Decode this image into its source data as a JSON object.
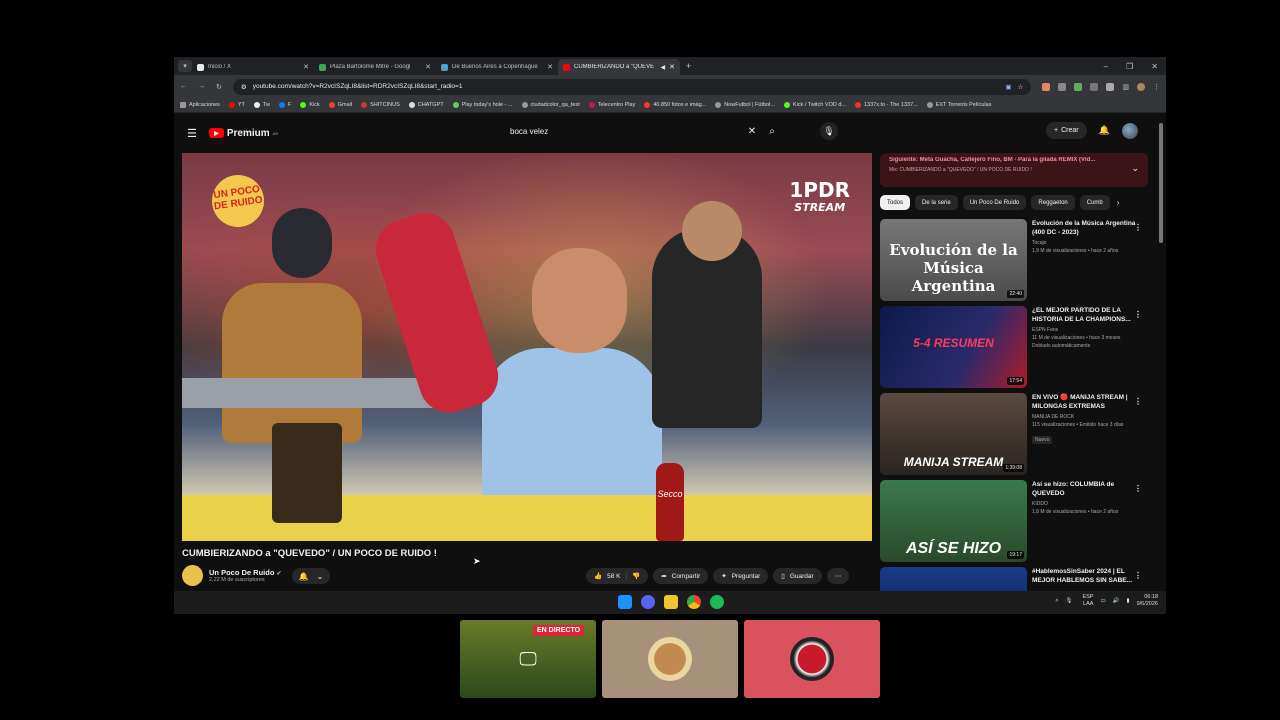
{
  "browser": {
    "tabs": [
      {
        "title": "Inicio / X",
        "color": "#e8eaed",
        "active": false
      },
      {
        "title": "Plaza Bartolomé Mitre - Googl",
        "color": "#34a853",
        "active": false
      },
      {
        "title": "De Buenos Aires a Copenhague",
        "color": "#4aa0d8",
        "active": false
      },
      {
        "title": "CUMBIERIZANDO a \"QUEVE",
        "color": "#ff0000",
        "active": true
      }
    ],
    "new_tab": "+",
    "window_controls": {
      "minimize": "–",
      "maximize": "❐",
      "close": "✕"
    },
    "url": "youtube.com/watch?v=R2vcISZqLI8&list=RDR2vcISZqLI8&start_radio=1",
    "bookmarks": [
      "Aplicaciones",
      "YT",
      "Tw",
      "F",
      "Kick",
      "Gmail",
      "SHITCINUS",
      "CHATGPT",
      "Play today's hole - ...",
      "ciudadcolor_qa_test",
      "Telecentro Play",
      "40.850 fotos e imág...",
      "NowFutbol | Fútbol...",
      "Kick / Twitch VOD d...",
      "1337x.to - The 1337...",
      "EXT Torrents Películas"
    ]
  },
  "youtube": {
    "logo_text": "Premium",
    "logo_sup": "AR",
    "search_query": "boca velez",
    "create_label": "Crear",
    "video": {
      "title": "CUMBIERIZANDO a \"QUEVEDO\" / UN POCO DE RUIDO !",
      "overlay_logo_left": "UN POCO DE RUIDO",
      "overlay_logo_right_main": "1PDR",
      "overlay_logo_right_sub": "STREAM",
      "bottle_label": "Secco"
    },
    "channel": {
      "name": "Un Poco De Ruido",
      "subscribers": "2,22 M de suscriptores"
    },
    "actions": {
      "likes": "58 K",
      "share": "Compartir",
      "ask": "Preguntar",
      "save": "Guardar"
    },
    "up_next": {
      "line1": "Siguiente: Meta Guacha, Callejero Fino, BM - Para la gilada REMIX (Vid...",
      "line2": "Mix: CUMBIERIZANDO a \"QUEVEDO\" / UN POCO DE RUIDO !"
    },
    "chips": [
      "Todos",
      "De la serie",
      "Un Poco De Ruido",
      "Reggaeton",
      "Cumb"
    ],
    "recommendations": [
      {
        "title": "Evolución de la Música Argentina (400 DC - 2023)",
        "channel": "Tocajo",
        "views": "1,9 M de visualizaciones • hace 2 años",
        "duration": "22:40",
        "thumb_text": "Evolución de la Música Argentina",
        "thumb_color": "#6a6a6a"
      },
      {
        "title": "¿EL MEJOR PARTIDO DE LA HISTORIA DE LA CHAMPIONS...",
        "channel": "ESPN Fans",
        "views": "11 M de visualizaciones • hace 3 meses",
        "badge": "Doblado automáticamente",
        "duration": "17:54",
        "thumb_text": "5-4 RESUMEN",
        "thumb_color": "#1a2a5a"
      },
      {
        "title": "EN VIVO 🔴 MANIJA STREAM | MILONGAS EXTREMAS",
        "channel": "MANIJA DE ROCK",
        "views": "115 visualizaciones • Emitido hace 3 días",
        "badge": "Nuevo",
        "duration": "1:39:08",
        "thumb_text": "MANIJA STREAM",
        "thumb_color": "#3a3430"
      },
      {
        "title": "Así se hizo: COLUMBIA de QUEVEDO",
        "channel": "KIDDO",
        "views": "1,8 M de visualizaciones • hace 2 años",
        "duration": "19:17",
        "thumb_text": "ASÍ SE HIZO",
        "thumb_color": "#2a6a3a"
      },
      {
        "title": "#HablemosSinSaber 2024 | EL MEJOR HABLEMOS SIN SABE...",
        "channel": "",
        "views": "",
        "duration": "",
        "thumb_text": "",
        "thumb_color": "#1a3a8a"
      }
    ]
  },
  "taskbar": {
    "lang": "ESP LAA",
    "time": "06:18",
    "date": "9/6/2026"
  },
  "call": {
    "live_label": "EN DIRECTO"
  }
}
